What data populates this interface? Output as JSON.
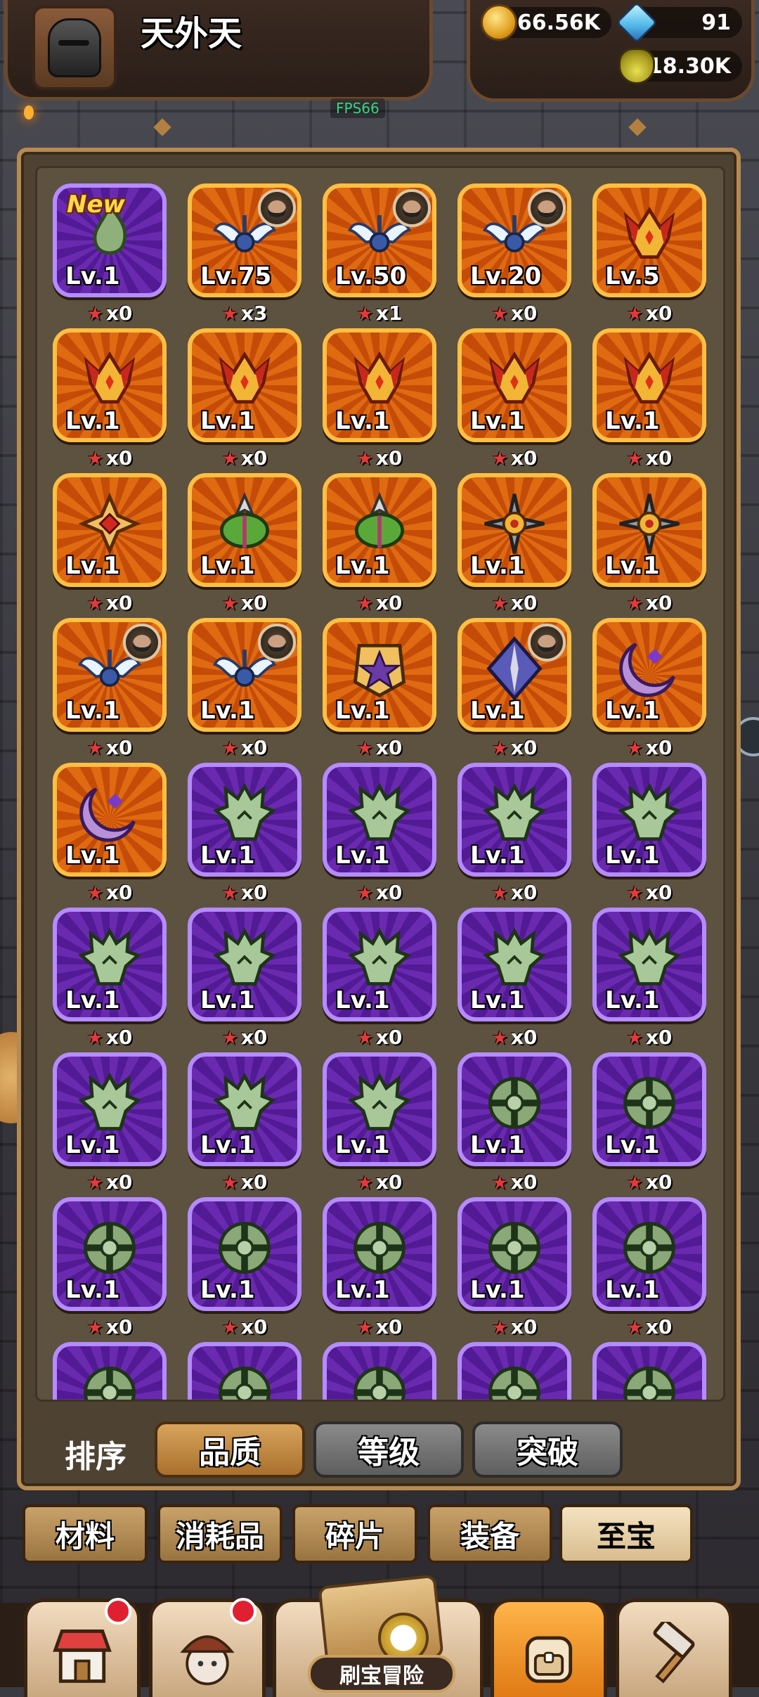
{
  "header": {
    "player_name": "天外天",
    "resources": {
      "gold": "166.56K",
      "gems": "91",
      "potion": "18.30K"
    },
    "fps": "FPS66"
  },
  "inventory": {
    "items": [
      {
        "lv": "Lv.1",
        "count": "x0",
        "rarity": "purple",
        "icon": "green-flame-icon",
        "new": "New"
      },
      {
        "lv": "Lv.75",
        "count": "x3",
        "rarity": "orange",
        "icon": "winged-emblem-icon",
        "hero": true
      },
      {
        "lv": "Lv.50",
        "count": "x1",
        "rarity": "orange",
        "icon": "winged-emblem-icon",
        "hero": true
      },
      {
        "lv": "Lv.20",
        "count": "x0",
        "rarity": "orange",
        "icon": "winged-emblem-icon",
        "hero": true
      },
      {
        "lv": "Lv.5",
        "count": "x0",
        "rarity": "orange",
        "icon": "demon-crest-icon"
      },
      {
        "lv": "Lv.1",
        "count": "x0",
        "rarity": "orange",
        "icon": "demon-crest-icon"
      },
      {
        "lv": "Lv.1",
        "count": "x0",
        "rarity": "orange",
        "icon": "demon-crest-icon"
      },
      {
        "lv": "Lv.1",
        "count": "x0",
        "rarity": "orange",
        "icon": "demon-crest-icon"
      },
      {
        "lv": "Lv.1",
        "count": "x0",
        "rarity": "orange",
        "icon": "demon-crest-icon"
      },
      {
        "lv": "Lv.1",
        "count": "x0",
        "rarity": "orange",
        "icon": "demon-crest-icon"
      },
      {
        "lv": "Lv.1",
        "count": "x0",
        "rarity": "orange",
        "icon": "cross-shield-icon"
      },
      {
        "lv": "Lv.1",
        "count": "x0",
        "rarity": "orange",
        "icon": "green-mantis-icon"
      },
      {
        "lv": "Lv.1",
        "count": "x0",
        "rarity": "orange",
        "icon": "green-mantis-icon"
      },
      {
        "lv": "Lv.1",
        "count": "x0",
        "rarity": "orange",
        "icon": "shuriken-icon"
      },
      {
        "lv": "Lv.1",
        "count": "x0",
        "rarity": "orange",
        "icon": "shuriken-icon"
      },
      {
        "lv": "Lv.1",
        "count": "x0",
        "rarity": "orange",
        "icon": "winged-emblem-icon",
        "hero": true
      },
      {
        "lv": "Lv.1",
        "count": "x0",
        "rarity": "orange",
        "icon": "winged-emblem-icon",
        "hero": true
      },
      {
        "lv": "Lv.1",
        "count": "x0",
        "rarity": "orange",
        "icon": "star-badge-icon"
      },
      {
        "lv": "Lv.1",
        "count": "x0",
        "rarity": "orange",
        "icon": "diamond-spear-icon",
        "hero": true
      },
      {
        "lv": "Lv.1",
        "count": "x0",
        "rarity": "orange",
        "icon": "crescent-moon-icon"
      },
      {
        "lv": "Lv.1",
        "count": "x0",
        "rarity": "orange",
        "icon": "crescent-moon-icon"
      },
      {
        "lv": "Lv.1",
        "count": "x0",
        "rarity": "purple",
        "icon": "dragon-head-icon"
      },
      {
        "lv": "Lv.1",
        "count": "x0",
        "rarity": "purple",
        "icon": "dragon-head-icon"
      },
      {
        "lv": "Lv.1",
        "count": "x0",
        "rarity": "purple",
        "icon": "dragon-head-icon"
      },
      {
        "lv": "Lv.1",
        "count": "x0",
        "rarity": "purple",
        "icon": "dragon-head-icon"
      },
      {
        "lv": "Lv.1",
        "count": "x0",
        "rarity": "purple",
        "icon": "dragon-head-icon"
      },
      {
        "lv": "Lv.1",
        "count": "x0",
        "rarity": "purple",
        "icon": "dragon-head-icon"
      },
      {
        "lv": "Lv.1",
        "count": "x0",
        "rarity": "purple",
        "icon": "dragon-head-icon"
      },
      {
        "lv": "Lv.1",
        "count": "x0",
        "rarity": "purple",
        "icon": "dragon-head-icon"
      },
      {
        "lv": "Lv.1",
        "count": "x0",
        "rarity": "purple",
        "icon": "dragon-head-icon"
      },
      {
        "lv": "Lv.1",
        "count": "x0",
        "rarity": "purple",
        "icon": "dragon-head-icon"
      },
      {
        "lv": "Lv.1",
        "count": "x0",
        "rarity": "purple",
        "icon": "dragon-head-icon"
      },
      {
        "lv": "Lv.1",
        "count": "x0",
        "rarity": "purple",
        "icon": "dragon-head-icon"
      },
      {
        "lv": "Lv.1",
        "count": "x0",
        "rarity": "purple",
        "icon": "green-cross-shield-icon"
      },
      {
        "lv": "Lv.1",
        "count": "x0",
        "rarity": "purple",
        "icon": "green-cross-shield-icon"
      },
      {
        "lv": "Lv.1",
        "count": "x0",
        "rarity": "purple",
        "icon": "green-cross-shield-icon"
      },
      {
        "lv": "Lv.1",
        "count": "x0",
        "rarity": "purple",
        "icon": "green-cross-shield-icon"
      },
      {
        "lv": "Lv.1",
        "count": "x0",
        "rarity": "purple",
        "icon": "green-cross-shield-icon"
      },
      {
        "lv": "Lv.1",
        "count": "x0",
        "rarity": "purple",
        "icon": "green-cross-shield-icon"
      },
      {
        "lv": "Lv.1",
        "count": "x0",
        "rarity": "purple",
        "icon": "green-cross-shield-icon"
      },
      {
        "lv": "",
        "count": "",
        "rarity": "purple",
        "icon": "green-cross-shield-icon"
      },
      {
        "lv": "",
        "count": "",
        "rarity": "purple",
        "icon": "green-cross-shield-icon"
      },
      {
        "lv": "",
        "count": "",
        "rarity": "purple",
        "icon": "green-cross-shield-icon"
      },
      {
        "lv": "",
        "count": "",
        "rarity": "purple",
        "icon": "green-cross-shield-icon"
      },
      {
        "lv": "",
        "count": "",
        "rarity": "purple",
        "icon": "green-cross-shield-icon"
      }
    ]
  },
  "sort": {
    "label": "排序",
    "options": [
      "品质",
      "等级",
      "突破"
    ],
    "active": 0
  },
  "categories": {
    "tabs": [
      "材料",
      "消耗品",
      "碎片",
      "装备",
      "至宝"
    ],
    "active": 4
  },
  "bottom_nav": {
    "adventure_label": "刷宝冒险"
  }
}
